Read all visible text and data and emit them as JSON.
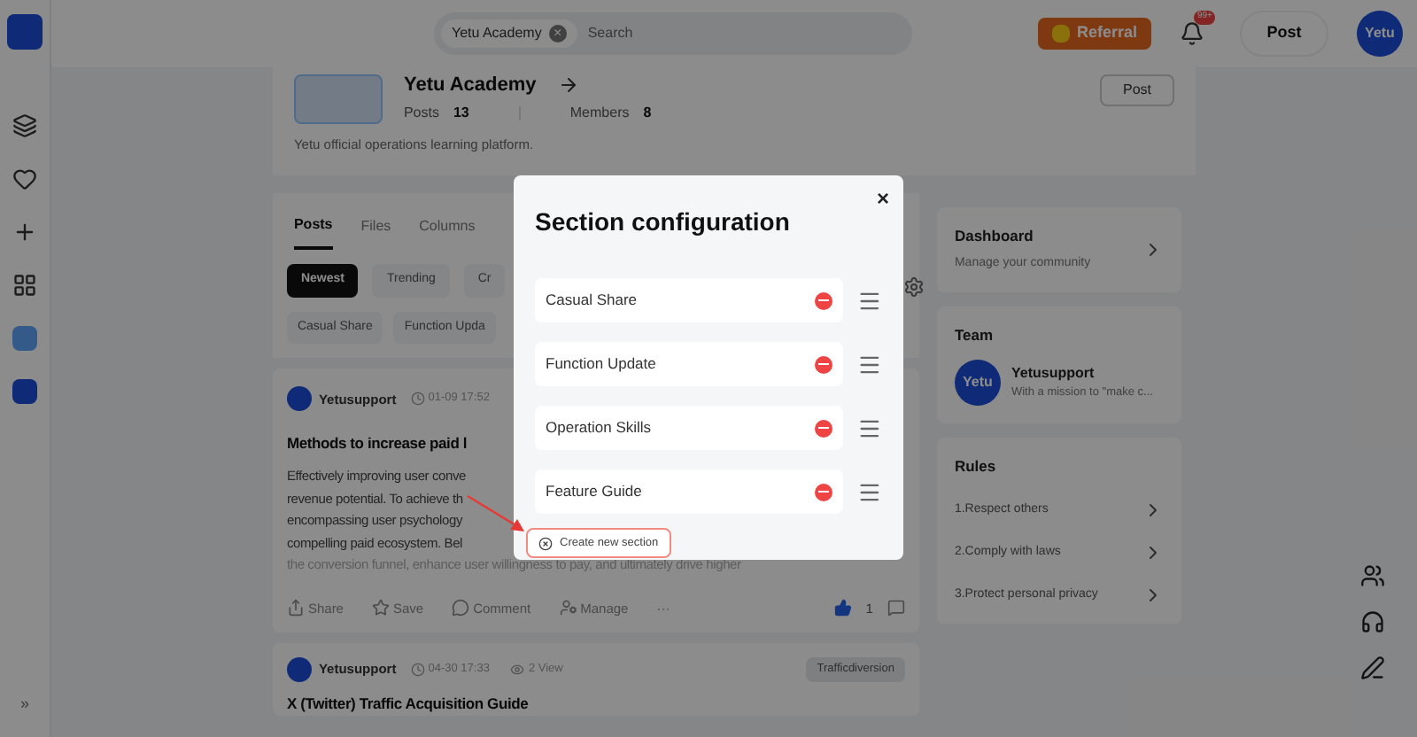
{
  "topbar": {
    "search_chip": "Yetu Academy",
    "search_chip_close": "×",
    "search_placeholder": "Search",
    "referral": "Referral",
    "notification_badge": "99+",
    "post_button": "Post",
    "avatar": "Yetu"
  },
  "sidebar": {
    "expand": "»"
  },
  "community": {
    "title": "Yetu Academy",
    "posts_label": "Posts",
    "posts_count": "13",
    "members_label": "Members",
    "members_count": "8",
    "post_button": "Post",
    "description": "Yetu official operations learning platform."
  },
  "tabs": [
    {
      "label": "Posts",
      "selected": true
    },
    {
      "label": "Files",
      "selected": false
    },
    {
      "label": "Columns",
      "selected": false
    }
  ],
  "sort_chips": [
    {
      "label": "Newest",
      "selected": true
    },
    {
      "label": "Trending",
      "selected": false
    },
    {
      "label": "Cr",
      "selected": false
    }
  ],
  "section_chips": [
    "Casual Share",
    "Function Upda"
  ],
  "posts": [
    {
      "author": "Yetusupport",
      "time": "01-09 17:52",
      "title": "Methods to increase paid l",
      "body_lines": [
        "Effectively improving user conve",
        "revenue potential. To achieve th",
        "encompassing user psychology",
        "compelling paid ecosystem. Bel"
      ],
      "faded_line": "the conversion funnel, enhance user willingness to pay, and ultimately drive higher",
      "actions": [
        {
          "kind": "share",
          "label": "Share"
        },
        {
          "kind": "save",
          "label": "Save"
        },
        {
          "kind": "comment",
          "label": "Comment"
        },
        {
          "kind": "manage",
          "label": "Manage"
        },
        {
          "kind": "more",
          "label": "···"
        }
      ],
      "likes": "1"
    },
    {
      "author": "Yetusupport",
      "time": "04-30 17:33",
      "views": "2 View",
      "tag": "Trafficdiversion",
      "title": "X (Twitter) Traffic Acquisition Guide"
    }
  ],
  "dashboard": {
    "title": "Dashboard",
    "subtitle": "Manage your community"
  },
  "team": {
    "title": "Team",
    "avatar": "Yetu",
    "name": "Yetusupport",
    "bio": "With a mission to \"make c..."
  },
  "rules": {
    "title": "Rules",
    "items": [
      "1.Respect others",
      "2.Comply with laws",
      "3.Protect personal privacy"
    ]
  },
  "modal": {
    "title": "Section configuration",
    "close": "×",
    "sections": [
      "Casual Share",
      "Function Update",
      "Operation Skills",
      "Feature Guide"
    ],
    "create_button": "Create new section"
  }
}
